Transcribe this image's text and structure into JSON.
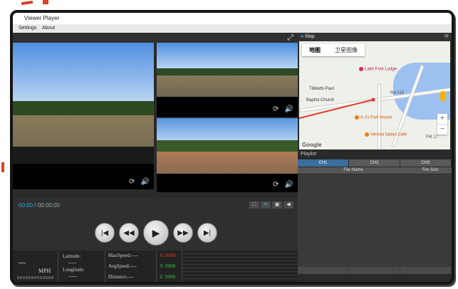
{
  "window": {
    "title": "Viewer Player"
  },
  "menu": [
    "Settings",
    "About"
  ],
  "player": {
    "time_current": "00:00",
    "time_separator": " / ",
    "time_total": "00:00:00",
    "speed_display": "---",
    "speed_unit": "MPH",
    "latitude_label": "Latitude:",
    "latitude_value": "-----",
    "longitude_label": "Longitude:",
    "longitude_value": "-----",
    "maxspeed_label": "MaxSpeed:----",
    "avgspeed_label": "AvgSpeed:----",
    "distance_label": "Distance:----",
    "g_x": "X: 0000",
    "g_y": "Y: 0000",
    "g_z": "Z: 0000"
  },
  "map": {
    "panel_title": "Map",
    "tabs": [
      "地图",
      "卫星图像"
    ],
    "places": [
      "Lake Fork Lodge",
      "Tibbetts Paul",
      "Baptist Church",
      "A J's Fish House",
      "Verona Italian Cafe",
      "Rd 515",
      "FM 17"
    ],
    "footer": "Google"
  },
  "playlist": {
    "title": "Playlist",
    "channels": [
      "CH1",
      "CH2",
      "CH3"
    ],
    "columns": [
      "File Name",
      "File Size"
    ]
  }
}
